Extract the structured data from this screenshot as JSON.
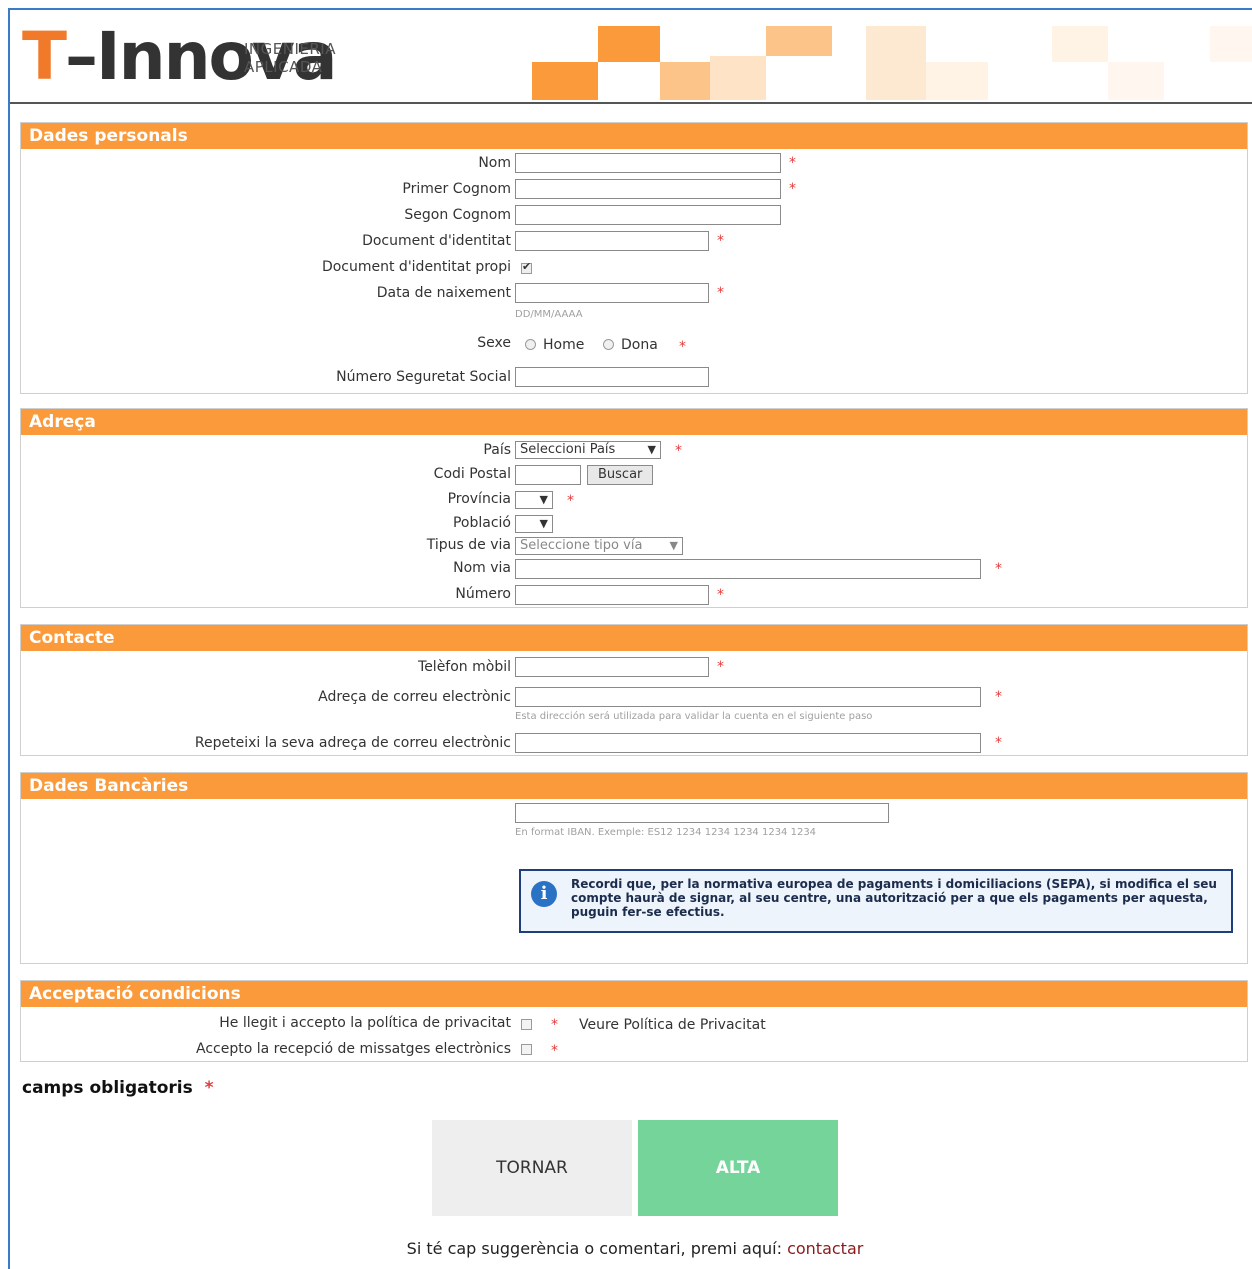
{
  "logo": {
    "t": "T",
    "rest": "–Innova",
    "tagline": "INGENIERIA APLICADA"
  },
  "colors": {
    "accent": "#fb9a3b",
    "required": "#e23b3b",
    "alta": "#74d499"
  },
  "sections": {
    "personal": "Dades personals",
    "address": "Adreça",
    "contact": "Contacte",
    "bank": "Dades Bancàries",
    "conditions": "Acceptació condicions"
  },
  "personal": {
    "nom": "Nom",
    "primer_cognom": "Primer Cognom",
    "segon_cognom": "Segon Cognom",
    "document": "Document d'identitat",
    "document_propi": "Document d'identitat propi",
    "data_naixement": "Data de naixement",
    "data_hint": "DD/MM/AAAA",
    "sexe": "Sexe",
    "home": "Home",
    "dona": "Dona",
    "nss": "Número Seguretat Social"
  },
  "address": {
    "pais": "País",
    "pais_select": "Seleccioni País",
    "codi_postal": "Codi Postal",
    "buscar": "Buscar",
    "provincia": "Província",
    "poblacio": "Població",
    "tipus_via": "Tipus de via",
    "tipus_via_select": "Seleccione tipo vía",
    "nom_via": "Nom via",
    "numero": "Número"
  },
  "contact": {
    "telefon": "Telèfon mòbil",
    "email": "Adreça de correu electrònic",
    "email_hint": "Esta dirección será utilizada para validar la cuenta en el siguiente paso",
    "email_repeat": "Repeteixi la seva adreça de correu electrònic"
  },
  "bank": {
    "iban_hint": "En format IBAN. Exemple: ES12 1234 1234 1234 1234 1234",
    "info": "Recordi que, per la normativa europea de pagaments i domiciliacions (SEPA), si modifica el seu compte haurà de signar, al seu centre, una autorització per a que els pagaments per aquesta, puguin fer-se efectius."
  },
  "conditions": {
    "privacy": "He llegit i accepto la política de privacitat",
    "privacy_link": "Veure Política de Privacitat",
    "messages": "Accepto la recepció de missatges electrònics"
  },
  "required_note": "camps obligatoris",
  "required_mark": "*",
  "buttons": {
    "back": "TORNAR",
    "submit": "ALTA"
  },
  "footer": {
    "text": "Si té cap suggerència o comentari, premi aquí:",
    "link": "contactar"
  }
}
